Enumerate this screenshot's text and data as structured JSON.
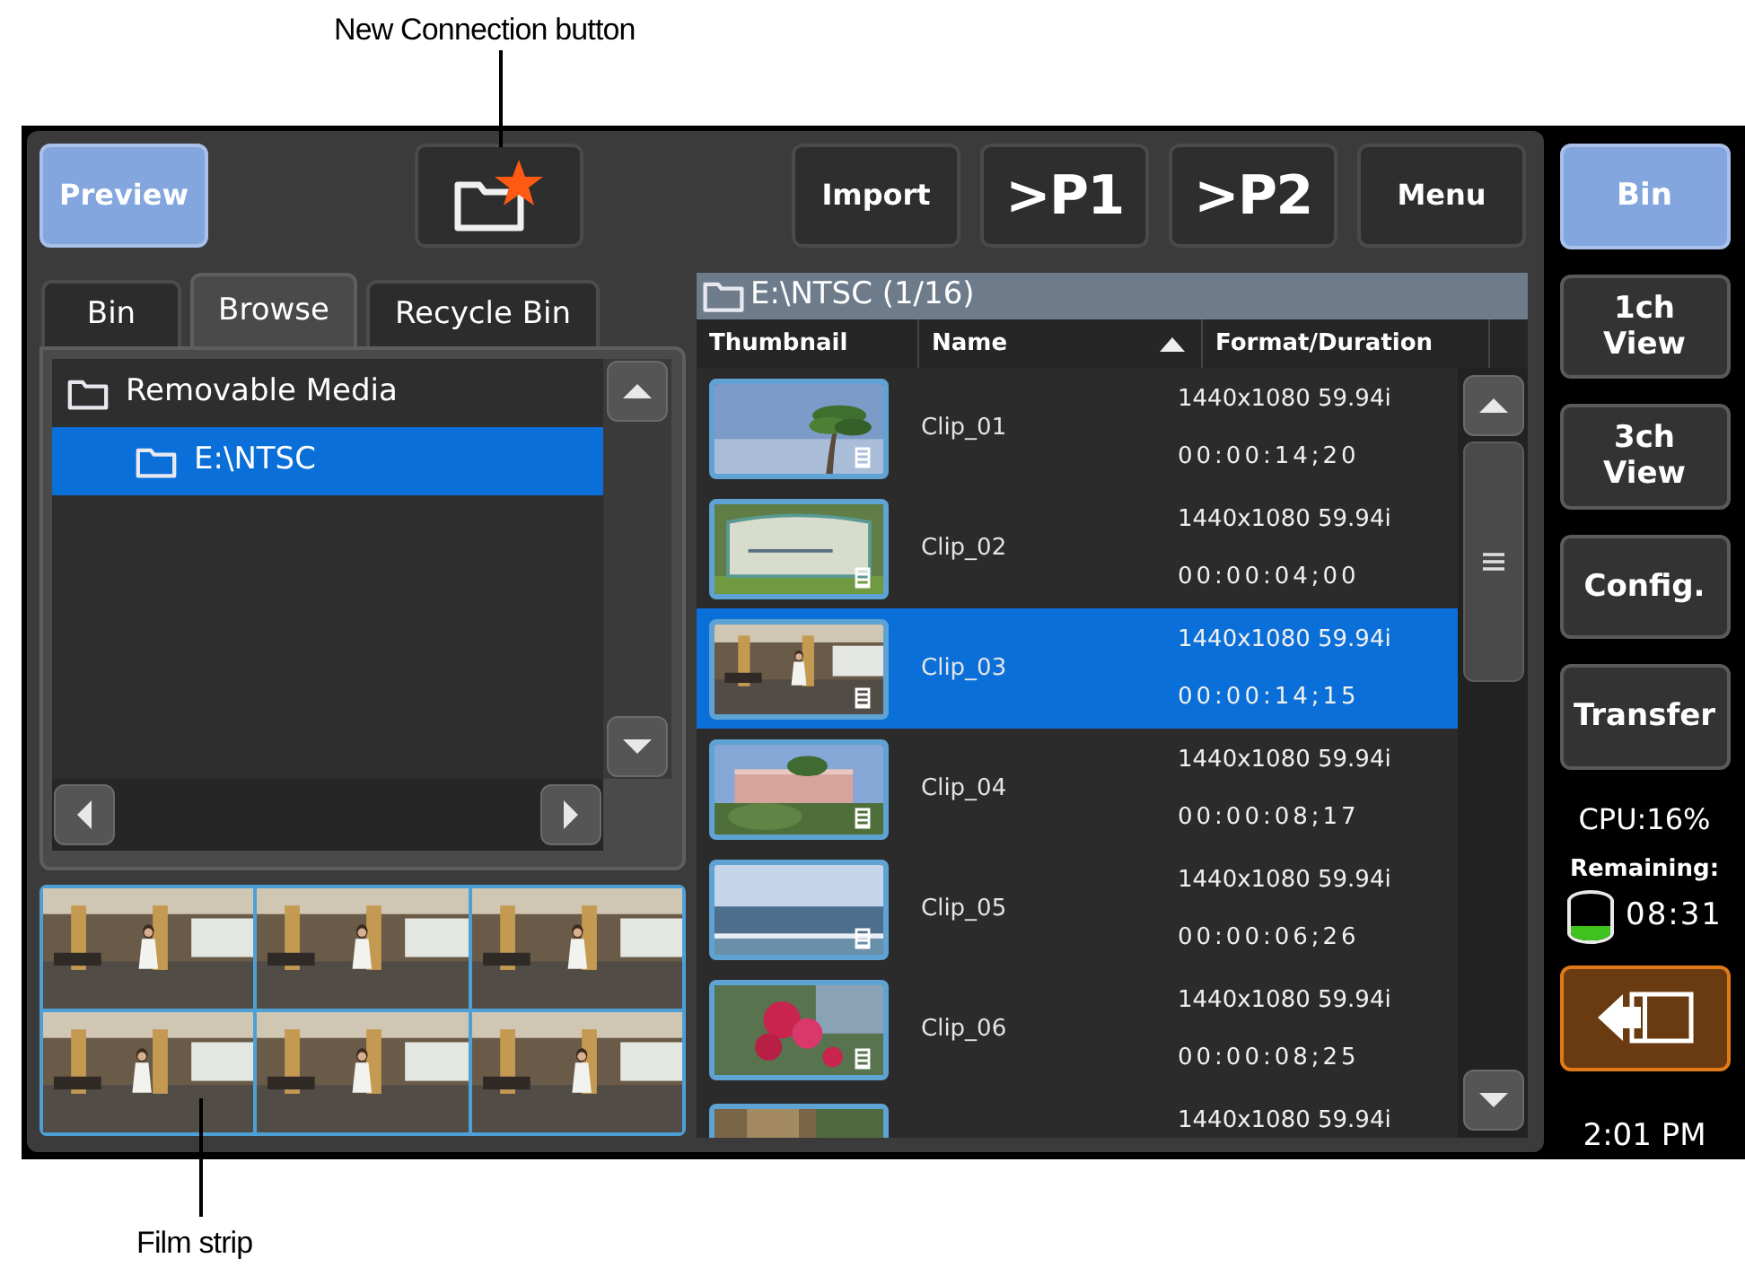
{
  "annotations": [
    {
      "text": "New Connection button"
    },
    {
      "text": "Film strip"
    }
  ],
  "toolbar": [
    {
      "kind": "toggle",
      "label": "Preview",
      "selected": true
    },
    {
      "kind": "new-connection"
    },
    {
      "kind": "text",
      "label": "Import"
    },
    {
      "kind": "big",
      "label": ">P1"
    },
    {
      "kind": "big",
      "label": ">P2"
    },
    {
      "kind": "text",
      "label": "Menu"
    }
  ],
  "tabs": [
    {
      "label": "Bin",
      "selected": false
    },
    {
      "label": "Browse",
      "selected": true
    },
    {
      "label": "Recycle Bin",
      "selected": false
    }
  ],
  "tree": [
    {
      "label": "Removable Media",
      "selected": false,
      "children": [
        {
          "label": "E:\\NTSC",
          "selected": true
        }
      ]
    }
  ],
  "clip_list": {
    "title": "E:\\NTSC (1/16)",
    "columns": [
      {
        "label": "Thumbnail",
        "sorted": false
      },
      {
        "label": "Name",
        "sorted": true
      },
      {
        "label": "Format/Duration",
        "sorted": false
      }
    ],
    "rows": [
      {
        "name": "Clip_01",
        "format": "1440x1080 59.94i",
        "duration": "00:00:14;20",
        "selected": false
      },
      {
        "name": "Clip_02",
        "format": "1440x1080 59.94i",
        "duration": "00:00:04;00",
        "selected": false
      },
      {
        "name": "Clip_03",
        "format": "1440x1080 59.94i",
        "duration": "00:00:14;15",
        "selected": true
      },
      {
        "name": "Clip_04",
        "format": "1440x1080 59.94i",
        "duration": "00:00:08;17",
        "selected": false
      },
      {
        "name": "Clip_05",
        "format": "1440x1080 59.94i",
        "duration": "00:00:06;26",
        "selected": false
      },
      {
        "name": "Clip_06",
        "format": "1440x1080 59.94i",
        "duration": "00:00:08;25",
        "selected": false
      },
      {
        "format": "1440x1080 59.94i",
        "selected": false
      }
    ]
  },
  "sidebar": {
    "buttons": [
      {
        "label": "Bin",
        "selected": true
      },
      {
        "label": "1ch View",
        "selected": false
      },
      {
        "label": "3ch View",
        "selected": false
      },
      {
        "label": "Config.",
        "selected": false
      },
      {
        "label": "Transfer",
        "selected": false
      }
    ],
    "cpu": "CPU:16%",
    "remaining_label": "Remaining:",
    "storage": {
      "level": 0.3
    },
    "remaining_time": "08:31",
    "clock": "2:01 PM"
  }
}
